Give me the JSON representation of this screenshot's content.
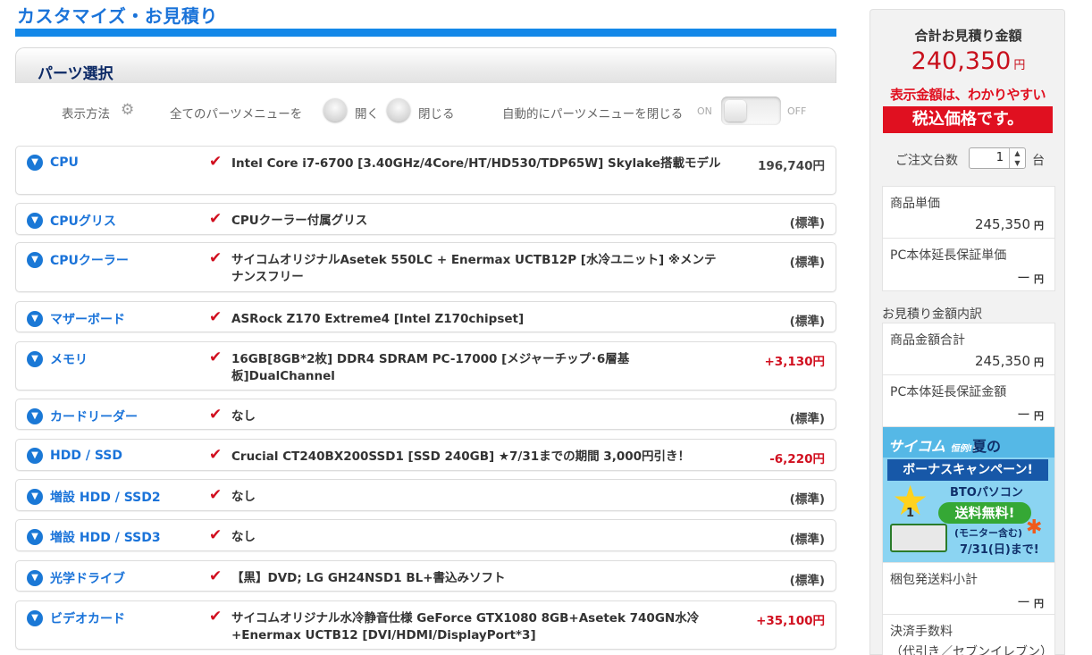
{
  "page": {
    "title": "カスタマイズ・お見積り"
  },
  "parts": {
    "header": "パーツ選択",
    "options": {
      "display_label": "表示方法",
      "all_menu_label": "全てのパーツメニューを",
      "open_label": "開く",
      "close_label": "閉じる",
      "auto_close_label": "自動的にパーツメニューを閉じる",
      "toggle_on": "ON",
      "toggle_off": "OFF"
    },
    "rows": [
      {
        "category": "CPU",
        "description": "Intel Core i7-6700 [3.40GHz/4Core/HT/HD530/TDP65W] Skylake搭載モデル",
        "price": "196,740円",
        "price_color": "#444444"
      },
      {
        "category": "CPUグリス",
        "description": "CPUクーラー付属グリス",
        "price": "(標準)",
        "price_color": "#444444"
      },
      {
        "category": "CPUクーラー",
        "description": "サイコムオリジナルAsetek 550LC + Enermax UCTB12P [水冷ユニット] ※メンテナンスフリー",
        "price": "(標準)",
        "price_color": "#444444"
      },
      {
        "category": "マザーボード",
        "description": "ASRock Z170 Extreme4 [Intel Z170chipset]",
        "price": "(標準)",
        "price_color": "#444444"
      },
      {
        "category": "メモリ",
        "description": "16GB[8GB*2枚] DDR4 SDRAM PC-17000 [メジャーチップ･6層基板]DualChannel",
        "price": "+3,130円",
        "price_color": "#d10f1f"
      },
      {
        "category": "カードリーダー",
        "description": "なし",
        "price": "(標準)",
        "price_color": "#444444"
      },
      {
        "category": "HDD / SSD",
        "description": "Crucial CT240BX200SSD1 [SSD 240GB] ★7/31までの期間 3,000円引き！",
        "price": "-6,220円",
        "price_color": "#d10f1f"
      },
      {
        "category": "増設 HDD / SSD2",
        "description": "なし",
        "price": "(標準)",
        "price_color": "#444444"
      },
      {
        "category": "増設 HDD / SSD3",
        "description": "なし",
        "price": "(標準)",
        "price_color": "#444444"
      },
      {
        "category": "光学ドライブ",
        "description": "【黒】DVD; LG GH24NSD1 BL+書込みソフト",
        "price": "(標準)",
        "price_color": "#444444"
      },
      {
        "category": "ビデオカード",
        "description": "サイコムオリジナル水冷静音仕様 GeForce GTX1080 8GB+Asetek 740GN水冷+Enermax UCTB12 [DVI/HDMI/DisplayPort*3]",
        "price": "+35,100円",
        "price_color": "#d10f1f"
      }
    ]
  },
  "sidebar": {
    "total_label": "合計お見積り金額",
    "total_value": "240,350",
    "total_unit": "円",
    "banner_line1": "表示金額は、わかりやすい",
    "banner_line2": "税込価格です。",
    "qty_label": "ご注文台数",
    "qty_value": "1",
    "qty_unit": "台",
    "unit_price_label": "商品単価",
    "unit_price_value": "245,350",
    "warranty_unit_label": "PC本体延長保証単価",
    "warranty_unit_value": "ー",
    "breakdown_label": "お見積り金額内訳",
    "subtotal_label": "商品金額合計",
    "subtotal_value": "245,350",
    "warranty_total_label": "PC本体延長保証金額",
    "warranty_total_value": "ー",
    "shipping_label": "梱包発送料小計",
    "shipping_value": "ー",
    "fee_label": "決済手数料",
    "fee_note": "（代引き／セブンイレブン）",
    "yen": "円",
    "promo": {
      "brand": "サイコム",
      "tag": "恒例!!",
      "season": "夏の",
      "campaign": "ボーナスキャンペーン!",
      "rank": "1",
      "product": "BTOパソコン",
      "free_shipping": "送料無料!",
      "monitor": "(モニター含む)",
      "deadline": "7/31(日)まで!"
    }
  }
}
